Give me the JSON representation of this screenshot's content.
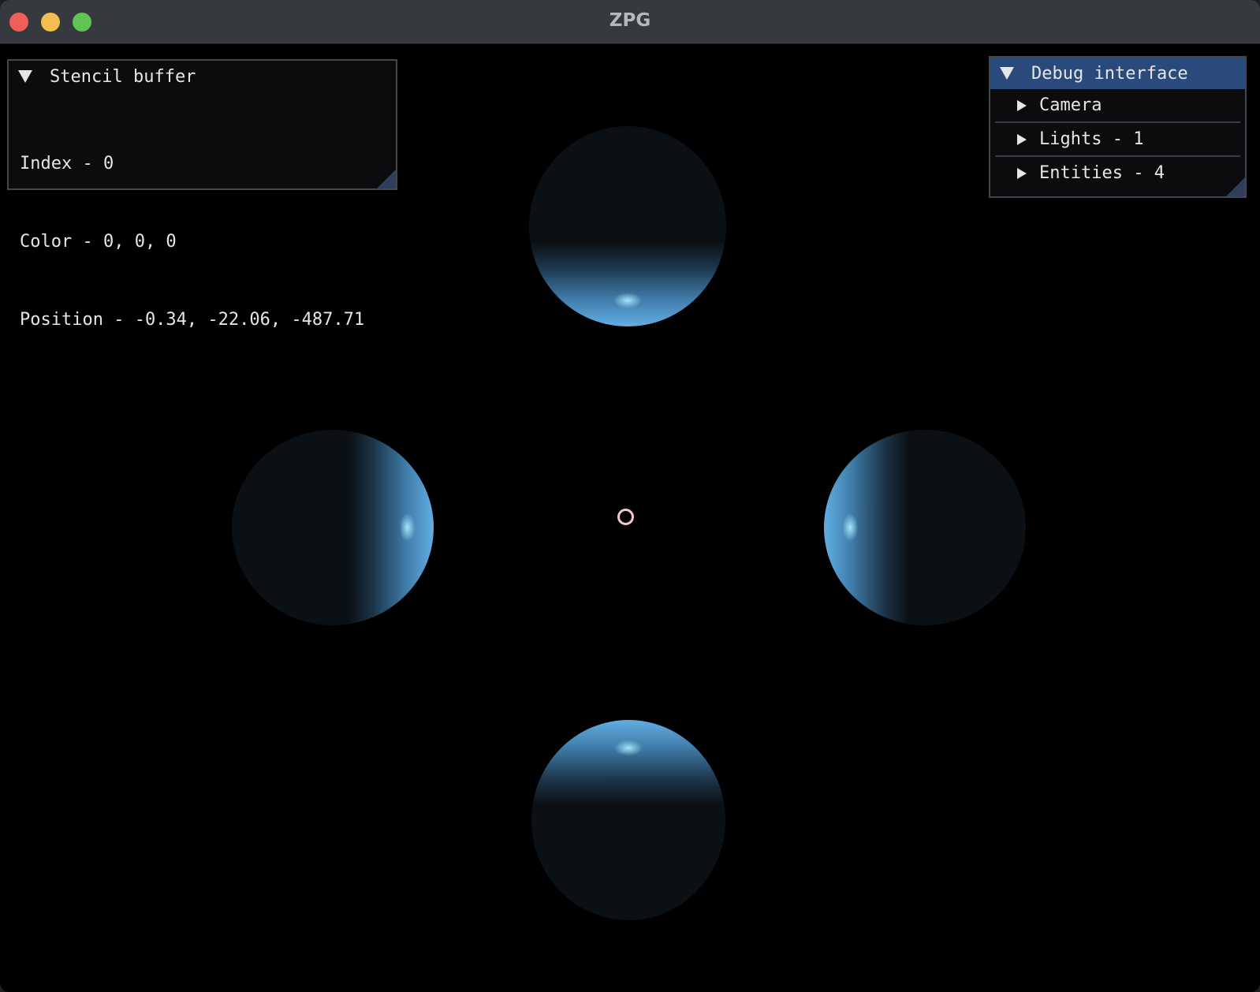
{
  "window": {
    "title": "ZPG"
  },
  "stencil_panel": {
    "title": "Stencil buffer",
    "index_line": "Index - 0",
    "color_line": "Color - 0, 0, 0",
    "position_line": "Position - -0.34, -22.06, -487.71"
  },
  "debug_panel": {
    "title": "Debug interface",
    "items": [
      {
        "label": "Camera"
      },
      {
        "label": "Lights - 1"
      },
      {
        "label": "Entities - 4"
      }
    ]
  },
  "colors": {
    "titlebar": "#36393d",
    "panel_header_active": "#294a7a",
    "sphere_highlight": "#62aee3",
    "crosshair": "#f1c9cd"
  }
}
